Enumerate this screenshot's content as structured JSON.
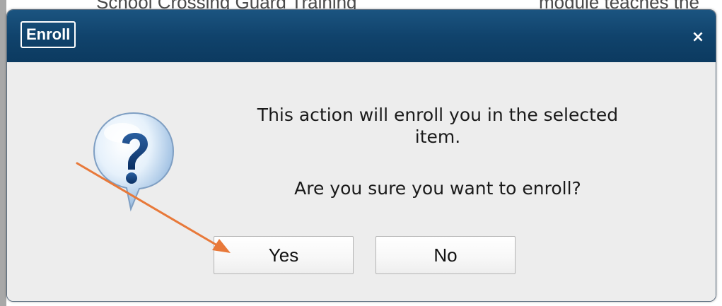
{
  "background": {
    "left_text": "School Crossing Guard Training",
    "right_text": "module teaches the",
    "bottom_right_text": "~~~~~~ ~~~~~~~~"
  },
  "dialog": {
    "title": "Enroll",
    "close_glyph": "×",
    "icon": "question-bubble-icon",
    "message": "This action will enroll you in the selected item.",
    "question": "Are you sure you want to enroll?",
    "yes_label": "Yes",
    "no_label": "No"
  },
  "colors": {
    "titlebar": "#10436c",
    "dialog_body": "#ededed",
    "annotation_arrow": "#e8793a"
  }
}
